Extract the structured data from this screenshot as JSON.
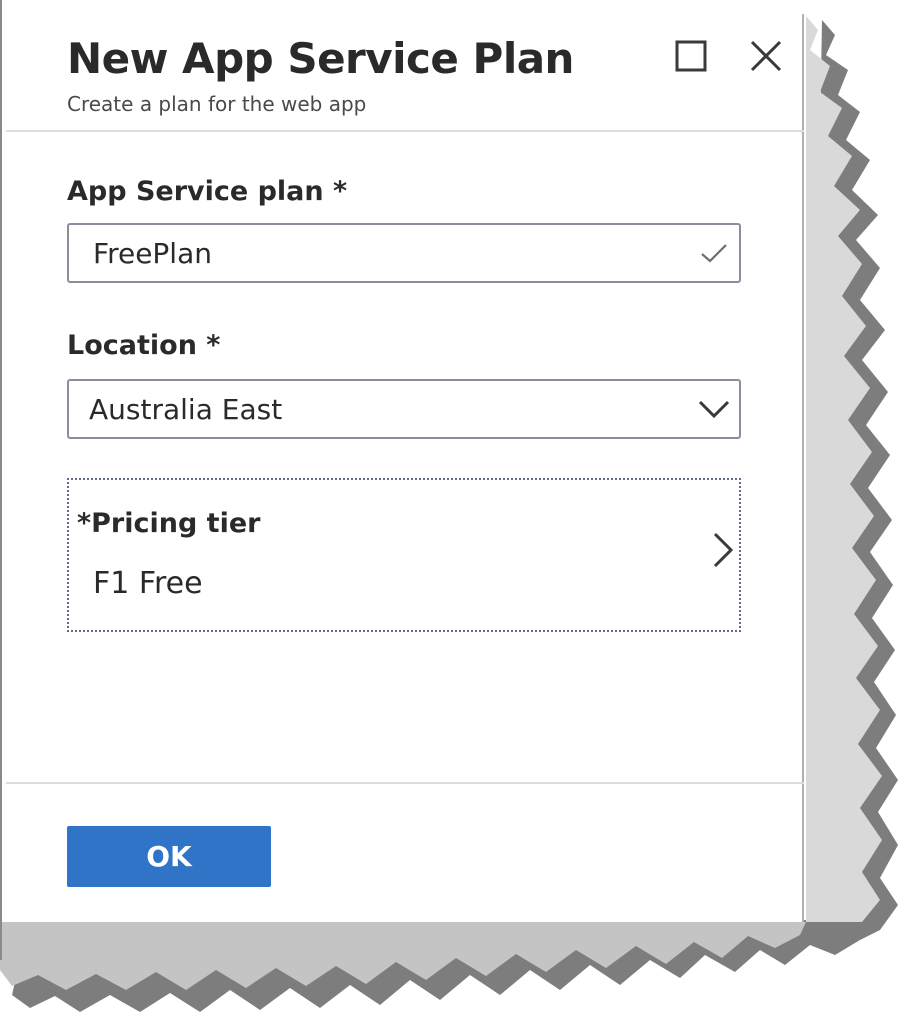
{
  "dialog": {
    "title": "New App Service Plan",
    "subtitle": "Create a plan for the web app",
    "maximize_icon": "maximize-icon",
    "close_icon": "close-icon"
  },
  "form": {
    "plan_label": "App Service plan *",
    "plan_value": "FreePlan",
    "plan_status_icon": "checkmark-icon",
    "location_label": "Location *",
    "location_value": "Australia East",
    "location_icon": "chevron-down-icon",
    "pricing_tier_label": "*Pricing tier",
    "pricing_tier_value": "F1 Free",
    "pricing_tier_icon": "chevron-right-icon"
  },
  "footer": {
    "ok_label": "OK"
  },
  "colors": {
    "accent": "#2f74c6",
    "input_border": "#8f8aa0",
    "text": "#2a2a2a"
  }
}
